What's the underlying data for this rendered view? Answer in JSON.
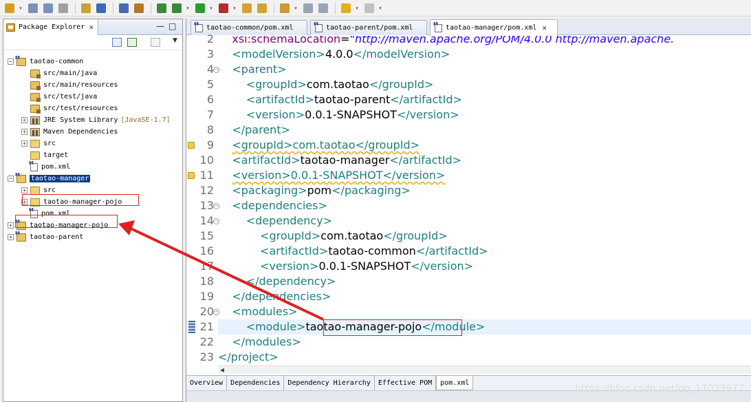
{
  "toolbar": {
    "icons": [
      "new-icon",
      "save-icon",
      "save-all-icon",
      "print-icon",
      "open-type-icon",
      "console-icon",
      "skip-breakpoints-icon",
      "new-package-icon",
      "refresh-icon",
      "debug-icon",
      "run-icon",
      "run-external-icon",
      "open-folder-icon",
      "open-file-icon",
      "search-icon",
      "next-annotation-icon",
      "prev-annotation-icon",
      "back-icon",
      "forward-icon"
    ]
  },
  "explorer": {
    "title": "Package Explorer",
    "close": "✕",
    "tree": [
      {
        "label": "taotao-common",
        "icon": "maven-project-icon",
        "expanded": true,
        "depth": 0
      },
      {
        "label": "src/main/java",
        "icon": "package-folder-icon",
        "depth": 1
      },
      {
        "label": "src/main/resources",
        "icon": "package-folder-icon",
        "depth": 1
      },
      {
        "label": "src/test/java",
        "icon": "package-folder-icon",
        "depth": 1
      },
      {
        "label": "src/test/resources",
        "icon": "package-folder-icon",
        "depth": 1
      },
      {
        "label": "JRE System Library",
        "decoration": "[JavaSE-1.7]",
        "icon": "library-icon",
        "depth": 1,
        "expandable": true
      },
      {
        "label": "Maven Dependencies",
        "icon": "library-icon",
        "depth": 1,
        "expandable": true
      },
      {
        "label": "src",
        "icon": "folder-icon",
        "depth": 1,
        "expandable": true
      },
      {
        "label": "target",
        "icon": "folder-icon",
        "depth": 1
      },
      {
        "label": "pom.xml",
        "icon": "xml-file-icon",
        "depth": 1
      },
      {
        "label": "taotao-manager",
        "icon": "maven-project-icon",
        "expanded": true,
        "depth": 0,
        "selected": true
      },
      {
        "label": "src",
        "icon": "folder-icon",
        "depth": 1,
        "expandable": true
      },
      {
        "label": "taotao-manager-pojo",
        "icon": "folder-icon",
        "depth": 1,
        "expandable": true
      },
      {
        "label": "pom.xml",
        "icon": "xml-file-icon",
        "depth": 1
      },
      {
        "label": "taotao-manager-pojo",
        "icon": "maven-project-icon",
        "depth": 0,
        "expandable": true
      },
      {
        "label": "taotao-parent",
        "icon": "maven-project-icon",
        "depth": 0,
        "expandable": true
      }
    ]
  },
  "editor": {
    "tabs": [
      {
        "label": "taotao-common/pom.xml",
        "active": false
      },
      {
        "label": "taotao-parent/pom.xml",
        "active": false
      },
      {
        "label": "taotao-manager/pom.xml",
        "active": true,
        "close": "✕"
      }
    ],
    "lines": [
      {
        "n": "2",
        "parts": [
          {
            "t": "    "
          },
          {
            "t": "xsi:schemaLocation",
            "c": "attr"
          },
          {
            "t": "="
          },
          {
            "t": "\"http://maven.apache.org/POM/4.0.0 http://maven.apache.",
            "c": "str"
          }
        ]
      },
      {
        "n": "3",
        "parts": [
          {
            "t": "    "
          },
          {
            "t": "<modelVersion>",
            "c": "t"
          },
          {
            "t": "4.0.0"
          },
          {
            "t": "</modelVersion>",
            "c": "t"
          }
        ]
      },
      {
        "n": "4",
        "parts": [
          {
            "t": "    "
          },
          {
            "t": "<parent>",
            "c": "t"
          }
        ]
      },
      {
        "n": "5",
        "parts": [
          {
            "t": "        "
          },
          {
            "t": "<groupId>",
            "c": "t"
          },
          {
            "t": "com.taotao"
          },
          {
            "t": "</groupId>",
            "c": "t"
          }
        ]
      },
      {
        "n": "6",
        "parts": [
          {
            "t": "        "
          },
          {
            "t": "<artifactId>",
            "c": "t"
          },
          {
            "t": "taotao-parent"
          },
          {
            "t": "</artifactId>",
            "c": "t"
          }
        ]
      },
      {
        "n": "7",
        "parts": [
          {
            "t": "        "
          },
          {
            "t": "<version>",
            "c": "t"
          },
          {
            "t": "0.0.1-SNAPSHOT"
          },
          {
            "t": "</version>",
            "c": "t"
          }
        ]
      },
      {
        "n": "8",
        "parts": [
          {
            "t": "    "
          },
          {
            "t": "</parent>",
            "c": "t"
          }
        ]
      },
      {
        "n": "9",
        "parts": [
          {
            "t": "    "
          },
          {
            "t": "<groupId>com.taotao</groupId>",
            "c": "t squig"
          }
        ]
      },
      {
        "n": "10",
        "parts": [
          {
            "t": "    "
          },
          {
            "t": "<artifactId>",
            "c": "t"
          },
          {
            "t": "taotao-manager"
          },
          {
            "t": "</artifactId>",
            "c": "t"
          }
        ]
      },
      {
        "n": "11",
        "parts": [
          {
            "t": "    "
          },
          {
            "t": "<version>0.0.1-SNAPSHOT</version>",
            "c": "t squig"
          }
        ]
      },
      {
        "n": "12",
        "parts": [
          {
            "t": "    "
          },
          {
            "t": "<packaging>",
            "c": "t"
          },
          {
            "t": "pom"
          },
          {
            "t": "</packaging>",
            "c": "t"
          }
        ]
      },
      {
        "n": "13",
        "parts": [
          {
            "t": "    "
          },
          {
            "t": "<dependencies>",
            "c": "t"
          }
        ]
      },
      {
        "n": "14",
        "parts": [
          {
            "t": "        "
          },
          {
            "t": "<dependency>",
            "c": "t"
          }
        ]
      },
      {
        "n": "15",
        "parts": [
          {
            "t": "            "
          },
          {
            "t": "<groupId>",
            "c": "t"
          },
          {
            "t": "com.taotao"
          },
          {
            "t": "</groupId>",
            "c": "t"
          }
        ]
      },
      {
        "n": "16",
        "parts": [
          {
            "t": "            "
          },
          {
            "t": "<artifactId>",
            "c": "t"
          },
          {
            "t": "taotao-common"
          },
          {
            "t": "</artifactId>",
            "c": "t"
          }
        ]
      },
      {
        "n": "17",
        "parts": [
          {
            "t": "            "
          },
          {
            "t": "<version>",
            "c": "t"
          },
          {
            "t": "0.0.1-SNAPSHOT"
          },
          {
            "t": "</version>",
            "c": "t"
          }
        ]
      },
      {
        "n": "18",
        "parts": [
          {
            "t": "        "
          },
          {
            "t": "</dependency>",
            "c": "t"
          }
        ]
      },
      {
        "n": "19",
        "parts": [
          {
            "t": "    "
          },
          {
            "t": "</dependencies>",
            "c": "t"
          }
        ]
      },
      {
        "n": "20",
        "parts": [
          {
            "t": "    "
          },
          {
            "t": "<modules>",
            "c": "t"
          }
        ]
      },
      {
        "n": "21",
        "parts": [
          {
            "t": "        "
          },
          {
            "t": "<module>",
            "c": "t"
          },
          {
            "t": "taotao-manager-pojo"
          },
          {
            "t": "</module>",
            "c": "t"
          }
        ],
        "highlight": true
      },
      {
        "n": "22",
        "parts": [
          {
            "t": "    "
          },
          {
            "t": "</modules>",
            "c": "t"
          }
        ]
      },
      {
        "n": "23",
        "parts": [
          {
            "t": "</project>",
            "c": "t"
          }
        ]
      }
    ],
    "bottom_tabs": [
      {
        "label": "Overview",
        "active": false
      },
      {
        "label": "Dependencies",
        "active": false
      },
      {
        "label": "Dependency Hierarchy",
        "active": false
      },
      {
        "label": "Effective POM",
        "active": false
      },
      {
        "label": "pom.xml",
        "active": true
      }
    ]
  },
  "watermark": "https://blog.csdn.net/qq_17023977",
  "colors": {
    "tag": "#1d7e7e",
    "attribute": "#7f007f",
    "string": "#2a00ff",
    "annotation": "#e02020",
    "selection": "#0b3c88"
  }
}
